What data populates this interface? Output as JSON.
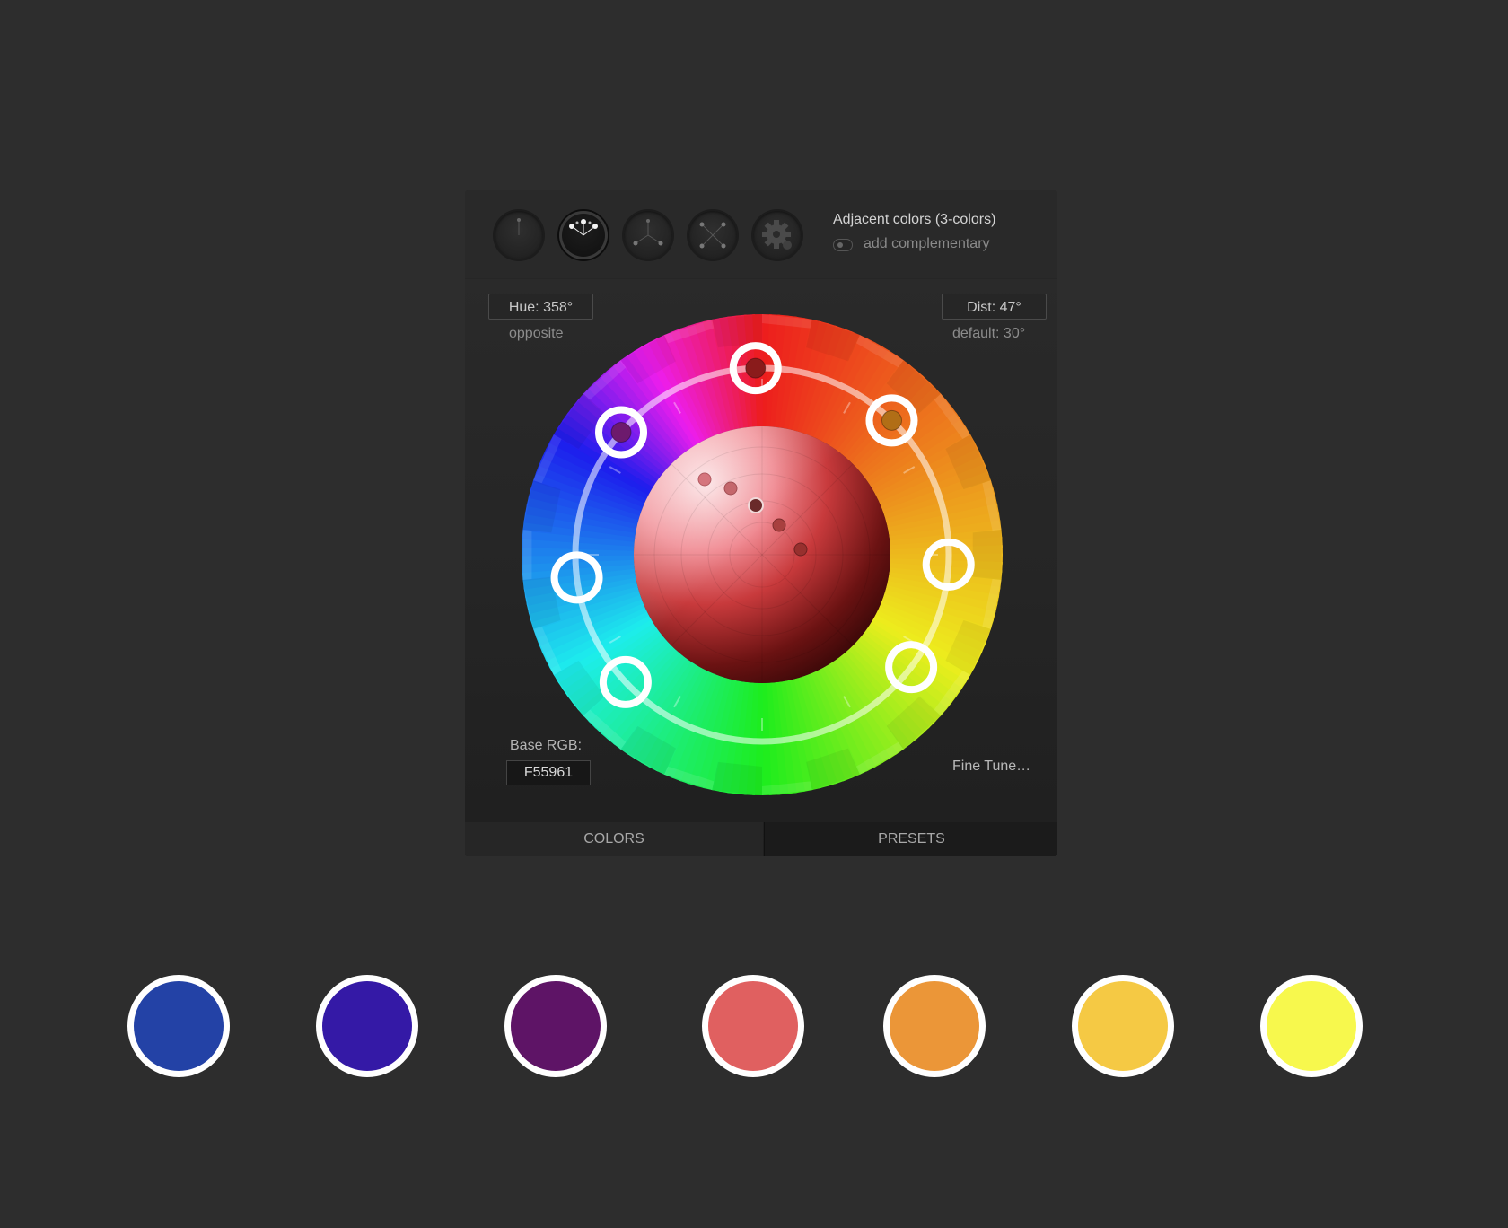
{
  "toolbar": {
    "modes": [
      {
        "name": "single-color",
        "icon": "single-dot-dial-icon",
        "active": false
      },
      {
        "name": "adjacent-colors",
        "icon": "adjacent-dots-dial-icon",
        "active": true
      },
      {
        "name": "triad",
        "icon": "triad-dial-icon",
        "active": false
      },
      {
        "name": "tetrad",
        "icon": "tetrad-dial-icon",
        "active": false
      },
      {
        "name": "custom",
        "icon": "gear-icon",
        "active": false
      }
    ],
    "mode_title": "Adjacent colors (3-colors)",
    "complementary_label": "add complementary",
    "complementary_on": false
  },
  "hue": {
    "value": "Hue: 358°",
    "sub": "opposite"
  },
  "dist": {
    "value": "Dist: 47°",
    "sub": "default: 30°"
  },
  "base": {
    "label": "Base RGB:",
    "value": "F55961"
  },
  "fine_tune": "Fine Tune…",
  "tabs": {
    "colors": "COLORS",
    "presets": "PRESETS"
  },
  "swatches": [
    {
      "name": "blue",
      "color": "#2342a6"
    },
    {
      "name": "indigo",
      "color": "#3419a6"
    },
    {
      "name": "purple",
      "color": "#5e1466"
    },
    {
      "name": "coral",
      "color": "#e06060"
    },
    {
      "name": "orange",
      "color": "#eb9638"
    },
    {
      "name": "gold",
      "color": "#f5c944"
    },
    {
      "name": "yellow",
      "color": "#f7f84d"
    }
  ],
  "wheel": {
    "handles": [
      {
        "name": "red-handle",
        "hue": 358,
        "fill": "#8a1b1b"
      },
      {
        "name": "orange-handle",
        "hue": 44,
        "fill": "#b16e16"
      },
      {
        "name": "purple-handle",
        "hue": 311,
        "fill": "#6d1a6d"
      },
      {
        "name": "yellow-handle",
        "hue": 93,
        "fill": ""
      },
      {
        "name": "blue-handle",
        "hue": 263,
        "fill": ""
      },
      {
        "name": "green-yellow-handle",
        "hue": 127,
        "fill": ""
      },
      {
        "name": "indigo-handle",
        "hue": 227,
        "fill": ""
      }
    ]
  }
}
